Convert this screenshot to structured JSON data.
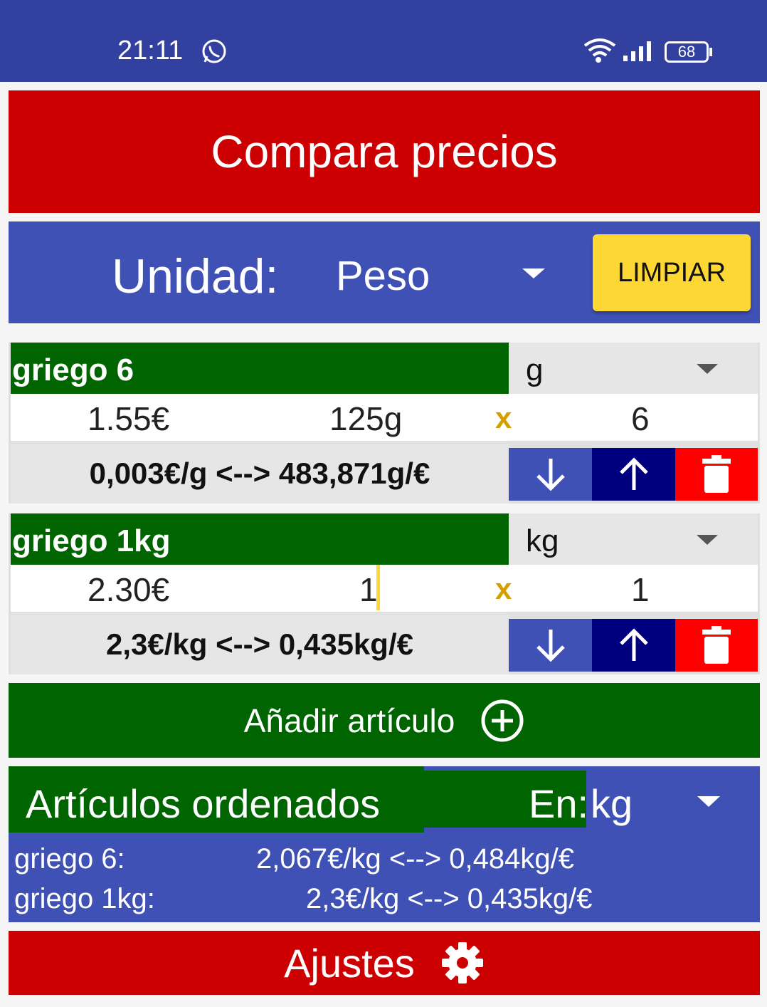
{
  "status_bar": {
    "time": "21:11",
    "battery": "68"
  },
  "header": {
    "title": "Compara precios"
  },
  "unit_bar": {
    "label": "Unidad:",
    "value": "Peso",
    "clear_label": "LIMPIAR"
  },
  "items": [
    {
      "name": "griego 6",
      "unit": "g",
      "price": "1.55€",
      "quantity": "125g",
      "times": "x",
      "multiplier": "6",
      "result": "0,003€/g <--> 483,871g/€"
    },
    {
      "name": "griego 1kg",
      "unit": "kg",
      "price": "2.30€",
      "quantity": "1",
      "times": "x",
      "multiplier": "1",
      "result": "2,3€/kg <--> 0,435kg/€"
    }
  ],
  "add_button": {
    "label": "Añadir artículo"
  },
  "sorted": {
    "title": "Artículos ordenados",
    "en_label": "En:",
    "unit": "kg",
    "rows": [
      {
        "name": "griego 6:",
        "value": "2,067€/kg <-->  0,484kg/€"
      },
      {
        "name": "griego 1kg:",
        "value": "2,3€/kg <-->  0,435kg/€"
      }
    ]
  },
  "settings": {
    "label": "Ajustes"
  },
  "colors": {
    "status": "#3241a0",
    "red": "#cc0000",
    "blue": "#3f51b5",
    "green": "#006400",
    "yellow": "#fdd835",
    "navy": "#00007f"
  },
  "icons": [
    "whatsapp-icon",
    "wifi-icon",
    "signal-icon",
    "battery-icon",
    "dropdown-icon",
    "arrow-down-icon",
    "arrow-up-icon",
    "trash-icon",
    "add-circle-icon",
    "gear-icon"
  ]
}
